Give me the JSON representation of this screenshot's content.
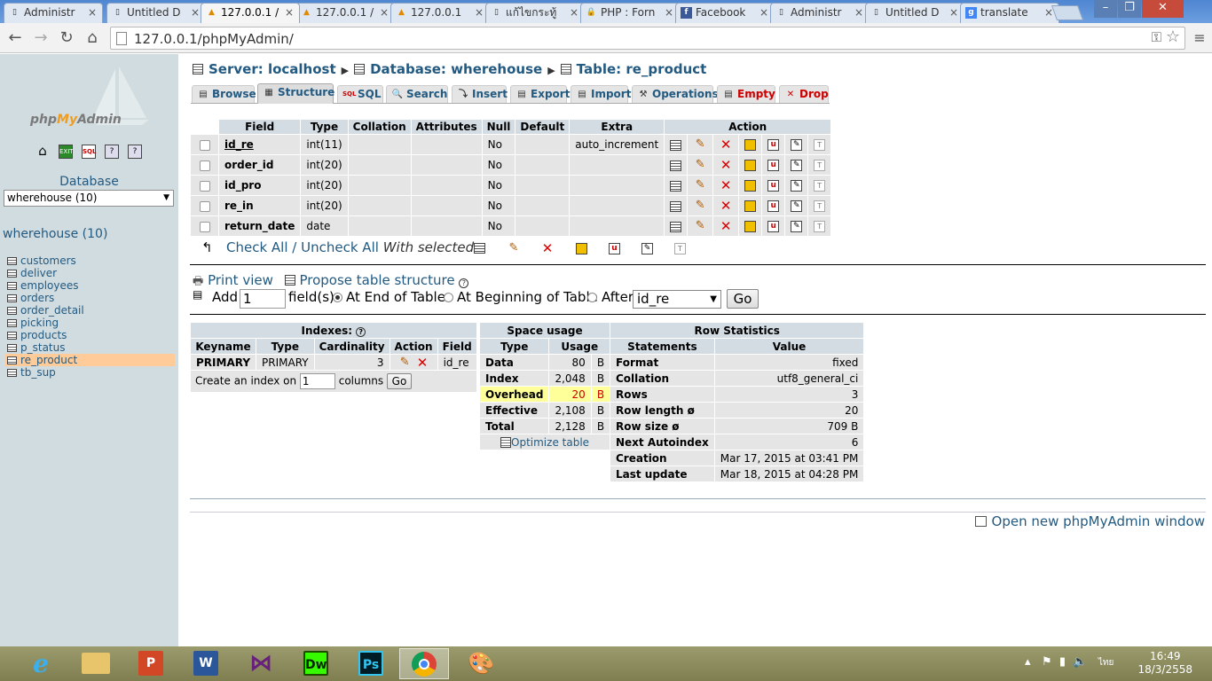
{
  "browser": {
    "tabs": [
      {
        "title": "Administr",
        "icon": "page-icon",
        "active": false
      },
      {
        "title": "Untitled D",
        "icon": "page-icon",
        "active": false
      },
      {
        "title": "127.0.0.1 /",
        "icon": "pma-icon",
        "active": true
      },
      {
        "title": "127.0.0.1 /",
        "icon": "pma-icon",
        "active": false
      },
      {
        "title": "127.0.0.1",
        "icon": "pma-icon",
        "active": false
      },
      {
        "title": "แก้ไขกระทู้",
        "icon": "page-icon",
        "active": false
      },
      {
        "title": "PHP : Forn",
        "icon": "lock-icon",
        "active": false
      },
      {
        "title": "Facebook",
        "icon": "facebook-icon",
        "active": false
      },
      {
        "title": "Administr",
        "icon": "page-icon",
        "active": false
      },
      {
        "title": "Untitled D",
        "icon": "page-icon",
        "active": false
      },
      {
        "title": "translate",
        "icon": "google-icon",
        "active": false
      }
    ],
    "url": "127.0.0.1/phpMyAdmin/"
  },
  "sidebar": {
    "logo_php": "php",
    "logo_my": "My",
    "logo_admin": "Admin",
    "database_label": "Database",
    "database_select": "wherehouse (10)",
    "db_title": "wherehouse (10)",
    "tables": [
      "customers",
      "deliver",
      "employees",
      "orders",
      "order_detail",
      "picking",
      "products",
      "p_status",
      "re_product",
      "tb_sup"
    ],
    "active_table": "re_product"
  },
  "breadcrumb": {
    "server": "Server: localhost",
    "database": "Database: wherehouse",
    "table": "Table: re_product"
  },
  "menu_tabs": [
    "Browse",
    "Structure",
    "SQL",
    "Search",
    "Insert",
    "Export",
    "Import",
    "Operations",
    "Empty",
    "Drop"
  ],
  "structure": {
    "headers": [
      "Field",
      "Type",
      "Collation",
      "Attributes",
      "Null",
      "Default",
      "Extra",
      "Action"
    ],
    "rows": [
      {
        "field": "id_re",
        "type": "int(11)",
        "collation": "",
        "attributes": "",
        "null": "No",
        "default": "",
        "extra": "auto_increment"
      },
      {
        "field": "order_id",
        "type": "int(20)",
        "collation": "",
        "attributes": "",
        "null": "No",
        "default": "",
        "extra": ""
      },
      {
        "field": "id_pro",
        "type": "int(20)",
        "collation": "",
        "attributes": "",
        "null": "No",
        "default": "",
        "extra": ""
      },
      {
        "field": "re_in",
        "type": "int(20)",
        "collation": "",
        "attributes": "",
        "null": "No",
        "default": "",
        "extra": ""
      },
      {
        "field": "return_date",
        "type": "date",
        "collation": "",
        "attributes": "",
        "null": "No",
        "default": "",
        "extra": ""
      }
    ],
    "check_all": "Check All",
    "slash": "/",
    "uncheck_all": "Uncheck All",
    "with_selected": "With selected:"
  },
  "actions": {
    "print_view": "Print view",
    "propose": "Propose table structure",
    "add_label": "Add",
    "add_value": "1",
    "fields_label": "field(s)",
    "at_end": "At End of Table",
    "at_beginning": "At Beginning of Table",
    "after": "After",
    "after_select": "id_re",
    "go": "Go"
  },
  "indexes": {
    "title": "Indexes:",
    "headers": [
      "Keyname",
      "Type",
      "Cardinality",
      "Action",
      "Field"
    ],
    "row": {
      "keyname": "PRIMARY",
      "type": "PRIMARY",
      "cardinality": "3",
      "field": "id_re"
    },
    "create_label": "Create an index on",
    "create_value": "1",
    "columns_label": "columns",
    "go": "Go"
  },
  "space_usage": {
    "title": "Space usage",
    "headers": [
      "Type",
      "Usage"
    ],
    "rows": [
      {
        "type": "Data",
        "value": "80",
        "unit": "B"
      },
      {
        "type": "Index",
        "value": "2,048",
        "unit": "B"
      },
      {
        "type": "Overhead",
        "value": "20",
        "unit": "B"
      },
      {
        "type": "Effective",
        "value": "2,108",
        "unit": "B"
      },
      {
        "type": "Total",
        "value": "2,128",
        "unit": "B"
      }
    ],
    "optimize": "Optimize table"
  },
  "row_statistics": {
    "title": "Row Statistics",
    "headers": [
      "Statements",
      "Value"
    ],
    "rows": [
      {
        "label": "Format",
        "value": "fixed"
      },
      {
        "label": "Collation",
        "value": "utf8_general_ci"
      },
      {
        "label": "Rows",
        "value": "3"
      },
      {
        "label": "Row length ø",
        "value": "20"
      },
      {
        "label": "Row size ø",
        "value": "709 B"
      },
      {
        "label": "Next Autoindex",
        "value": "6"
      },
      {
        "label": "Creation",
        "value": "Mar 17, 2015 at 03:41 PM"
      },
      {
        "label": "Last update",
        "value": "Mar 18, 2015 at 04:28 PM"
      }
    ]
  },
  "footer": {
    "open_new": "Open new phpMyAdmin window"
  },
  "taskbar": {
    "apps": [
      "Internet Explorer",
      "File Explorer",
      "PowerPoint",
      "Word",
      "Visual Studio",
      "Dw",
      "Ps",
      "Chrome",
      "Paint"
    ],
    "dw": "Dw",
    "ps": "Ps",
    "lang": "ไทย",
    "time": "16:49",
    "date": "18/3/2558"
  },
  "colors": {
    "link": "#235a81",
    "header_bg": "#d3dce3",
    "row_bg": "#e5e5e5",
    "sidebar_bg": "#d0dce0",
    "active_table": "#ffcc99"
  }
}
